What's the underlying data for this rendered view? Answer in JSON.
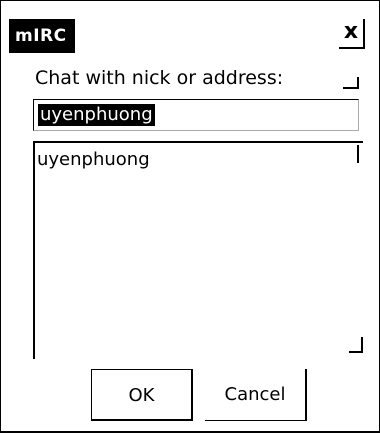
{
  "window": {
    "title": "mIRC",
    "close_symbol": "x"
  },
  "dialog": {
    "prompt": "Chat with nick or address:",
    "input_value": "uyenphuong",
    "list_items": [
      "uyenphuong"
    ]
  },
  "buttons": {
    "ok": "OK",
    "cancel": "Cancel"
  }
}
